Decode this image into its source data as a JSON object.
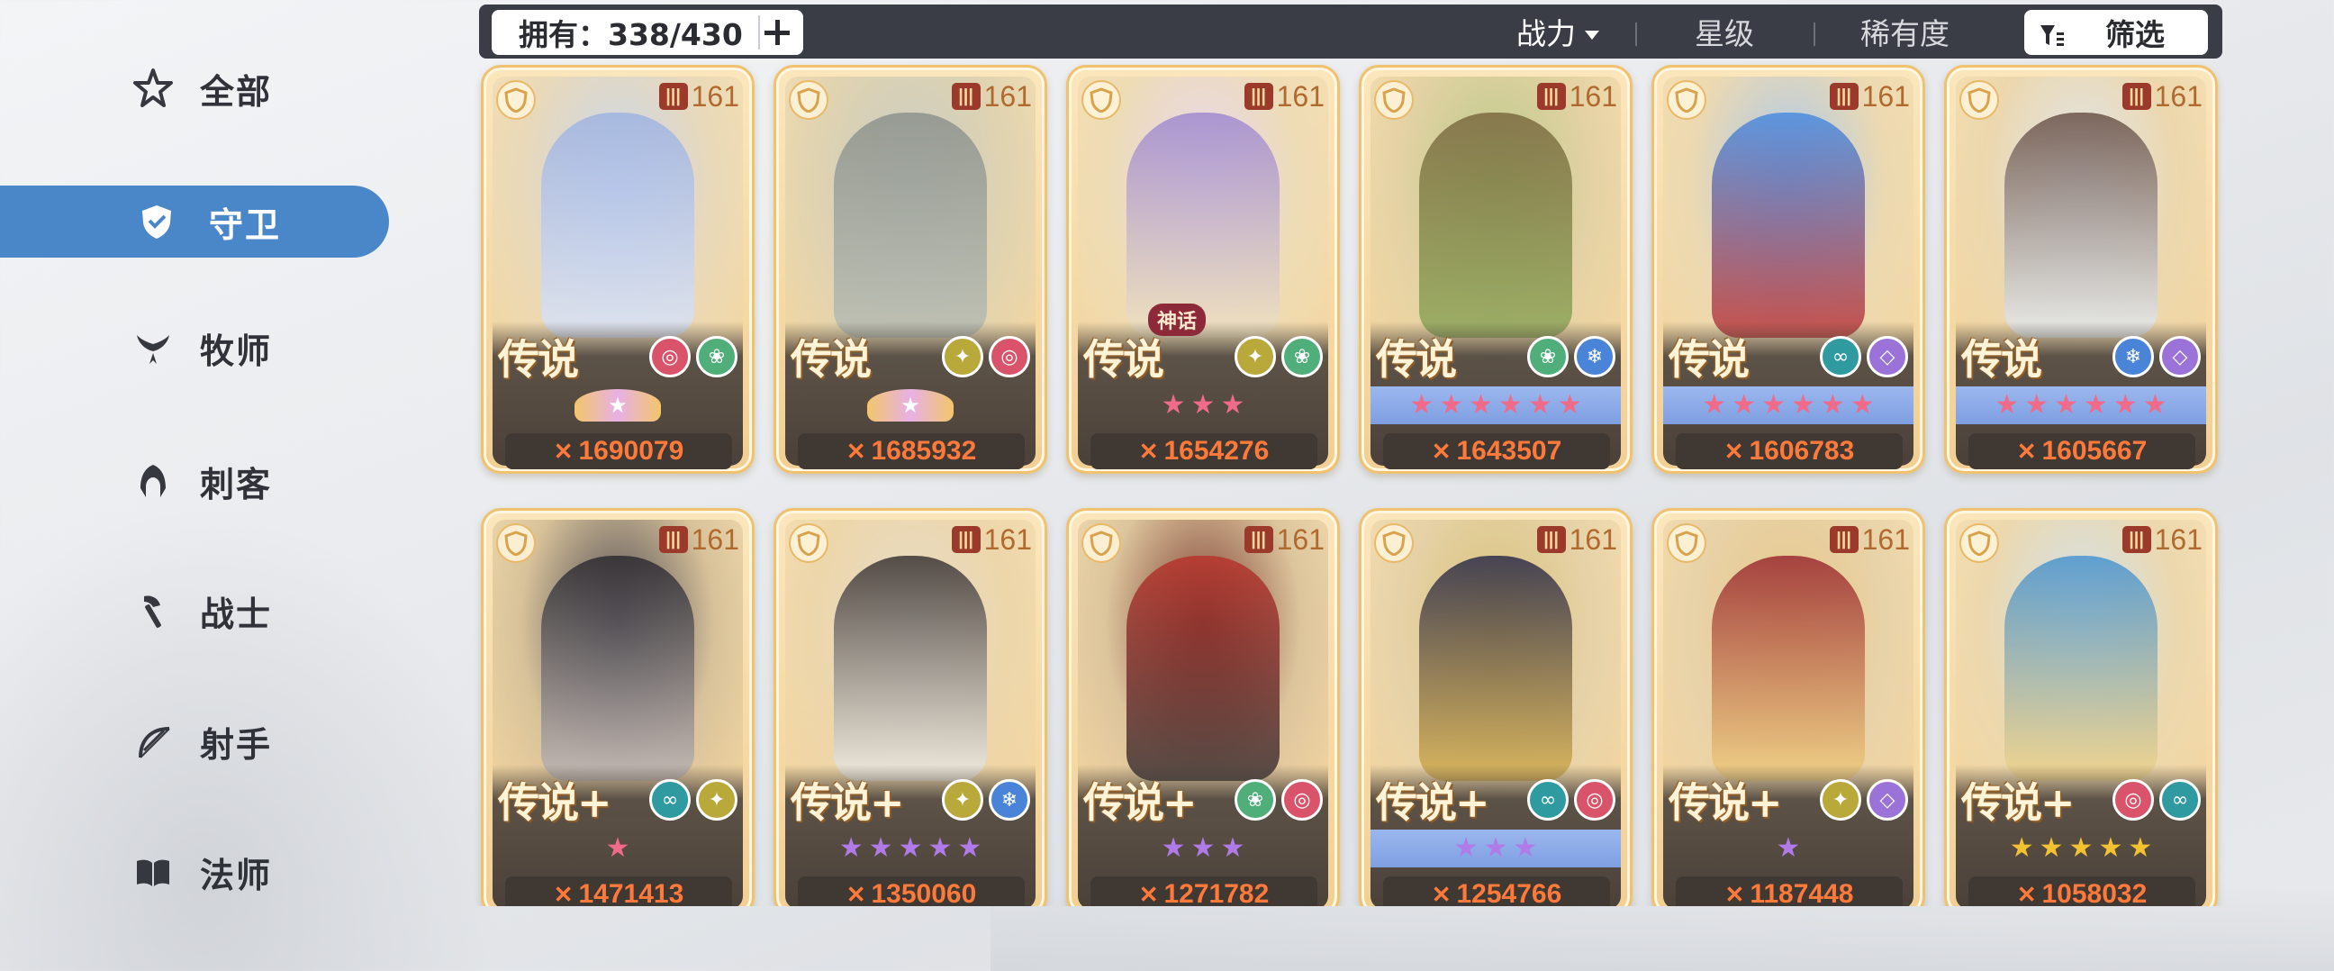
{
  "sidebar": {
    "items": [
      {
        "label": "全部",
        "icon": "star-outline-icon",
        "active": false
      },
      {
        "label": "守卫",
        "icon": "shield-icon",
        "active": true
      },
      {
        "label": "牧师",
        "icon": "wings-icon",
        "active": false
      },
      {
        "label": "刺客",
        "icon": "hood-icon",
        "active": false
      },
      {
        "label": "战士",
        "icon": "axe-icon",
        "active": false
      },
      {
        "label": "射手",
        "icon": "bow-icon",
        "active": false
      },
      {
        "label": "法师",
        "icon": "book-icon",
        "active": false
      }
    ]
  },
  "topbar": {
    "owned": "拥有：338/430",
    "sort_power": "战力",
    "sort_star": "星级",
    "sort_rarity": "稀有度",
    "filter": "筛选"
  },
  "cards": [
    {
      "rarity": "传说",
      "level": "161",
      "power": "1690079",
      "stars": "crown",
      "starbar": "dark",
      "elements": [
        "spiral",
        "lotus"
      ],
      "art": [
        "#c9d6ef",
        "#e9d9b8",
        "#9fb3e0",
        "#dbe4f6"
      ],
      "myth": ""
    },
    {
      "rarity": "传说",
      "level": "161",
      "power": "1685932",
      "stars": "crown",
      "starbar": "dark",
      "elements": [
        "wings",
        "spiral"
      ],
      "art": [
        "#c8ccc4",
        "#e0d3b0",
        "#8c928c",
        "#b8bdb4"
      ],
      "myth": ""
    },
    {
      "rarity": "传说",
      "level": "161",
      "power": "1654276",
      "stars": "3-red",
      "starbar": "dark",
      "elements": [
        "wings",
        "lotus"
      ],
      "art": [
        "#e6d7f2",
        "#eedcb5",
        "#a08ad0",
        "#f0e2c0"
      ],
      "myth": "神话"
    },
    {
      "rarity": "传说",
      "level": "161",
      "power": "1643507",
      "stars": "6-red",
      "starbar": "blue",
      "elements": [
        "lotus",
        "frost"
      ],
      "art": [
        "#b9c98a",
        "#e4d2a4",
        "#7c6a40",
        "#8fa85a"
      ],
      "myth": ""
    },
    {
      "rarity": "传说",
      "level": "161",
      "power": "1606783",
      "stars": "6-red",
      "starbar": "blue",
      "elements": [
        "wind",
        "void"
      ],
      "art": [
        "#a8c8f0",
        "#ecd9b1",
        "#4a8ce0",
        "#c03a3a"
      ],
      "myth": ""
    },
    {
      "rarity": "传说",
      "level": "161",
      "power": "1605667",
      "stars": "6-red",
      "starbar": "blue",
      "elements": [
        "frost",
        "void"
      ],
      "art": [
        "#dfe6ee",
        "#ecd7ad",
        "#6a5248",
        "#e8eef2"
      ],
      "myth": ""
    },
    {
      "rarity": "传说+",
      "level": "161",
      "power": "1471413",
      "stars": "1-red",
      "starbar": "dark",
      "elements": [
        "wind",
        "wings"
      ],
      "art": [
        "#4a4650",
        "#d8c29a",
        "#2c2a30",
        "#c0b8b8"
      ],
      "myth": ""
    },
    {
      "rarity": "传说+",
      "level": "161",
      "power": "1350060",
      "stars": "5-purple",
      "starbar": "dark",
      "elements": [
        "wings",
        "frost"
      ],
      "art": [
        "#e8dcc8",
        "#ecd6aa",
        "#3a3432",
        "#f2efe8"
      ],
      "myth": ""
    },
    {
      "rarity": "传说+",
      "level": "161",
      "power": "1271782",
      "stars": "3-purple",
      "starbar": "dark",
      "elements": [
        "lotus",
        "spiral"
      ],
      "art": [
        "#7a3a30",
        "#dcc49c",
        "#b8342c",
        "#3c3434"
      ],
      "myth": ""
    },
    {
      "rarity": "传说+",
      "level": "161",
      "power": "1254766",
      "stars": "3-purple",
      "starbar": "blue",
      "elements": [
        "wind",
        "spiral"
      ],
      "art": [
        "#d8c27a",
        "#e6d2a8",
        "#2c2c48",
        "#d6b050"
      ],
      "myth": ""
    },
    {
      "rarity": "传说+",
      "level": "161",
      "power": "1187448",
      "stars": "1-purple",
      "starbar": "dark",
      "elements": [
        "wings",
        "void"
      ],
      "art": [
        "#e6c88a",
        "#e8d2a8",
        "#9a2a30",
        "#f0d080"
      ],
      "myth": ""
    },
    {
      "rarity": "传说+",
      "level": "161",
      "power": "1058032",
      "stars": "5-gold",
      "starbar": "dark",
      "elements": [
        "spiral",
        "wind"
      ],
      "art": [
        "#cfe2f0",
        "#ecd8ae",
        "#4a94d0",
        "#f2d48a"
      ],
      "myth": ""
    }
  ],
  "colors": {
    "accent": "#4a87c8",
    "topbar": "#3a3d46",
    "power_text": "#ff7a3a",
    "star_red": "#f06a8a",
    "star_purple": "#b07ae8",
    "star_gold": "#f2c230"
  }
}
